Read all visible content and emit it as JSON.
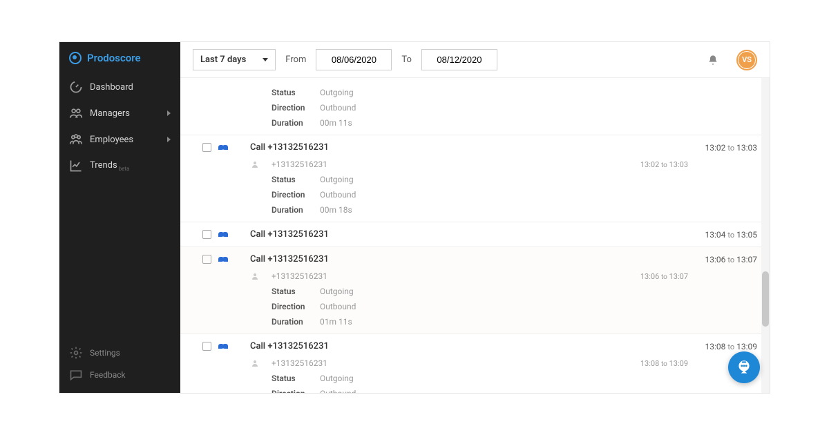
{
  "brand": "Prodoscore",
  "sidebar": {
    "items": [
      {
        "label": "Dashboard"
      },
      {
        "label": "Managers"
      },
      {
        "label": "Employees"
      },
      {
        "label": "Trends",
        "beta": "beta"
      }
    ],
    "bottom": [
      {
        "label": "Settings"
      },
      {
        "label": "Feedback"
      }
    ]
  },
  "topbar": {
    "range_label": "Last 7 days",
    "from_label": "From",
    "to_label": "To",
    "from_date": "08/06/2020",
    "to_date": "08/12/2020",
    "avatar_initials": "VS"
  },
  "labels": {
    "status": "Status",
    "direction": "Direction",
    "duration": "Duration",
    "to_word": "to"
  },
  "calls": [
    {
      "partial_top": true,
      "details": {
        "status": "Outgoing",
        "direction": "Outbound",
        "duration": "00m 11s"
      }
    },
    {
      "title": "Call +13132516231",
      "time_from": "13:02",
      "time_to": "13:03",
      "sub_number": "+13132516231",
      "sub_time_from": "13:02",
      "sub_time_to": "13:03",
      "details": {
        "status": "Outgoing",
        "direction": "Outbound",
        "duration": "00m 18s"
      }
    },
    {
      "title": "Call +13132516231",
      "time_from": "13:04",
      "time_to": "13:05",
      "collapsed": true
    },
    {
      "title": "Call +13132516231",
      "time_from": "13:06",
      "time_to": "13:07",
      "sub_number": "+13132516231",
      "sub_time_from": "13:06",
      "sub_time_to": "13:07",
      "details": {
        "status": "Outgoing",
        "direction": "Outbound",
        "duration": "01m 11s"
      },
      "alt": true
    },
    {
      "title": "Call +13132516231",
      "time_from": "13:08",
      "time_to": "13:09",
      "sub_number": "+13132516231",
      "sub_time_from": "13:08",
      "sub_time_to": "13:09",
      "details": {
        "status": "Outgoing",
        "direction": "Outbound"
      },
      "cut_bottom": true
    }
  ]
}
